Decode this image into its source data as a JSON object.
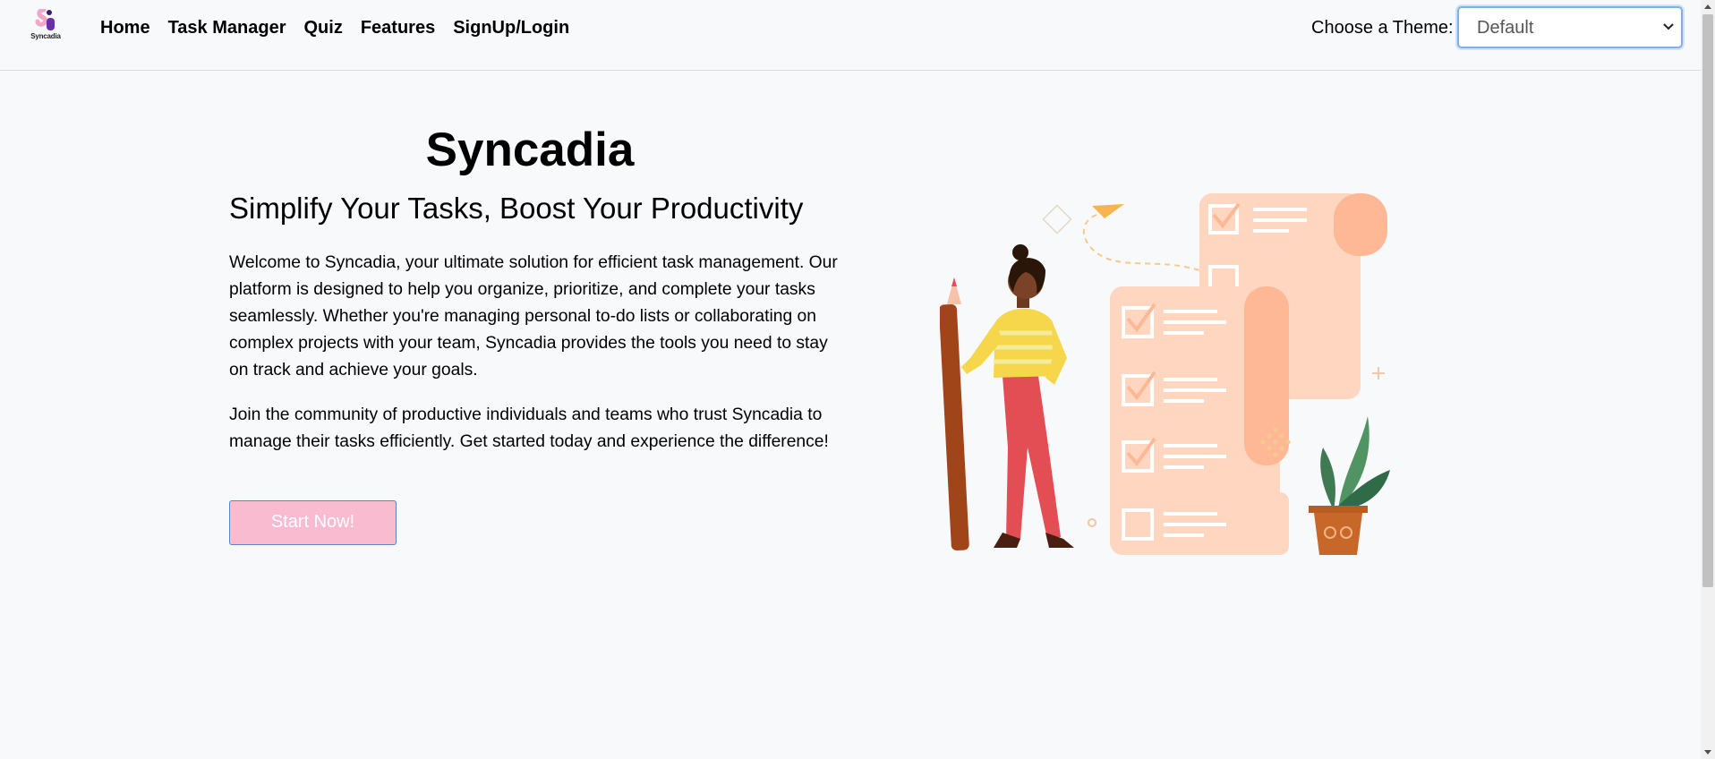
{
  "brand": {
    "name": "Syncadia",
    "logo_icon": "syncadia-logo-icon"
  },
  "nav": [
    {
      "label": "Home"
    },
    {
      "label": "Task Manager"
    },
    {
      "label": "Quiz"
    },
    {
      "label": "Features"
    },
    {
      "label": "SignUp/Login"
    }
  ],
  "theme": {
    "label": "Choose a Theme:",
    "selected": "Default"
  },
  "hero": {
    "title": "Syncadia",
    "subtitle": "Simplify Your Tasks, Boost Your Productivity",
    "paragraph1": "Welcome to Syncadia, your ultimate solution for efficient task management. Our platform is designed to help you organize, prioritize, and complete your tasks seamlessly. Whether you're managing personal to-do lists or collaborating on complex projects with your team, Syncadia provides the tools you need to stay on track and achieve your goals.",
    "paragraph2": "Join the community of productive individuals and teams who trust Syncadia to manage their tasks efficiently. Get started today and experience the difference!",
    "cta": "Start Now!"
  },
  "illustration": {
    "icon": "woman-with-pencil-checklist-illustration"
  },
  "colors": {
    "background": "#f8f9fb",
    "cta_bg": "#f8bbd0",
    "cta_border": "#5a86c7",
    "select_border": "#7fb1e6",
    "checklist": "#ffd6bf",
    "checklist_dark": "#ffb896"
  }
}
